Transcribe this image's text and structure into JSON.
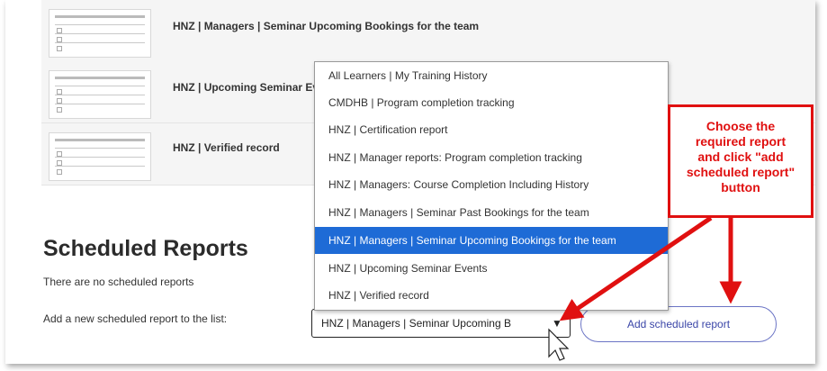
{
  "reports": [
    {
      "title": "HNZ | Managers | Seminar Upcoming Bookings for the team"
    },
    {
      "title": "HNZ | Upcoming Seminar Events"
    },
    {
      "title": "HNZ | Verified record"
    }
  ],
  "scheduled": {
    "heading": "Scheduled Reports",
    "empty_message": "There are no scheduled reports",
    "add_label": "Add a new scheduled report to the list:",
    "selected_value": "HNZ | Managers | Seminar Upcoming B",
    "add_button": "Add scheduled report"
  },
  "dropdown": {
    "options": [
      "All Learners | My Training History",
      "CMDHB | Program completion tracking",
      "HNZ | Certification report",
      "HNZ | Manager reports: Program completion tracking",
      "HNZ | Managers: Course Completion Including History",
      "HNZ | Managers | Seminar Past Bookings for the team",
      "HNZ | Managers | Seminar Upcoming Bookings for the team",
      "HNZ | Upcoming Seminar Events",
      "HNZ | Verified record"
    ],
    "selected_index": 6
  },
  "callout": {
    "lines": [
      "Choose the",
      "required report",
      "and click \"add",
      "scheduled report\"",
      "button"
    ]
  },
  "colors": {
    "selected_option": "#1e6bd6",
    "callout_red": "#e01010",
    "button_outline": "#6b74c5"
  },
  "icons": [
    "report-thumbnail-icon",
    "chevron-down-icon",
    "mouse-cursor-icon",
    "arrow-icon"
  ]
}
